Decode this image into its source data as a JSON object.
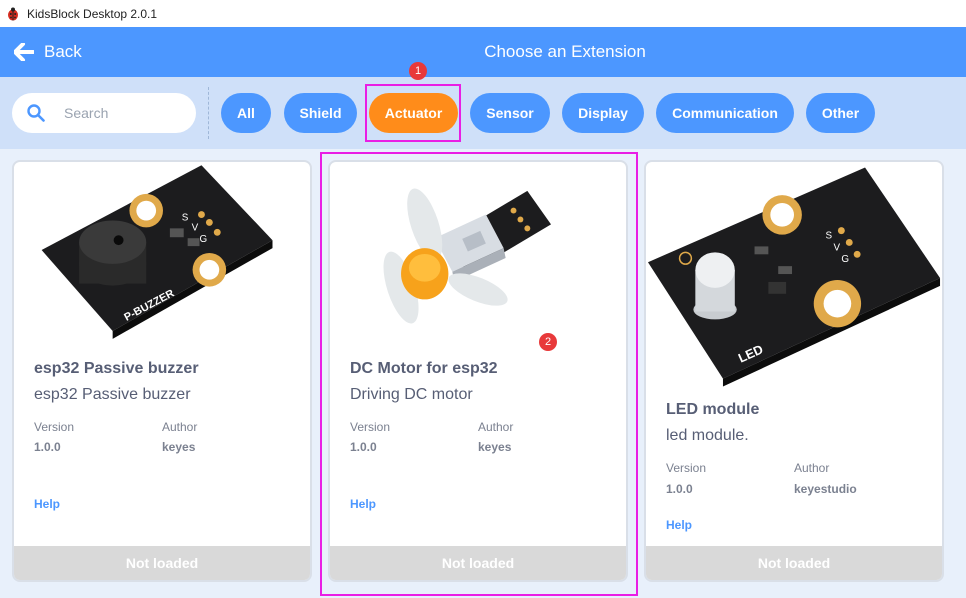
{
  "window": {
    "title": "KidsBlock Desktop 2.0.1"
  },
  "header": {
    "back_label": "Back",
    "title": "Choose an Extension"
  },
  "search": {
    "placeholder": "Search",
    "value": ""
  },
  "tags": [
    {
      "label": "All"
    },
    {
      "label": "Shield"
    },
    {
      "label": "Actuator",
      "active": true
    },
    {
      "label": "Sensor"
    },
    {
      "label": "Display"
    },
    {
      "label": "Communication"
    },
    {
      "label": "Other"
    }
  ],
  "annotations": [
    {
      "number": "1"
    },
    {
      "number": "2"
    }
  ],
  "meta_labels": {
    "version": "Version",
    "author": "Author"
  },
  "cards": [
    {
      "name": "esp32 Passive buzzer",
      "description": "esp32 Passive buzzer",
      "version": "1.0.0",
      "author": "keyes",
      "help": "Help",
      "status": "Not loaded",
      "image_label": "P-BUZZER"
    },
    {
      "name": "DC Motor for esp32",
      "description": "Driving DC motor",
      "version": "1.0.0",
      "author": "keyes",
      "help": "Help",
      "status": "Not loaded"
    },
    {
      "name": "LED module",
      "description": "led module.",
      "version": "1.0.0",
      "author": "keyestudio",
      "help": "Help",
      "status": "Not loaded",
      "image_label": "LED"
    }
  ],
  "colors": {
    "accent": "#4c97ff",
    "active_tag": "#ff8c1a",
    "highlight": "#e91ee5",
    "badge": "#e8393a"
  }
}
